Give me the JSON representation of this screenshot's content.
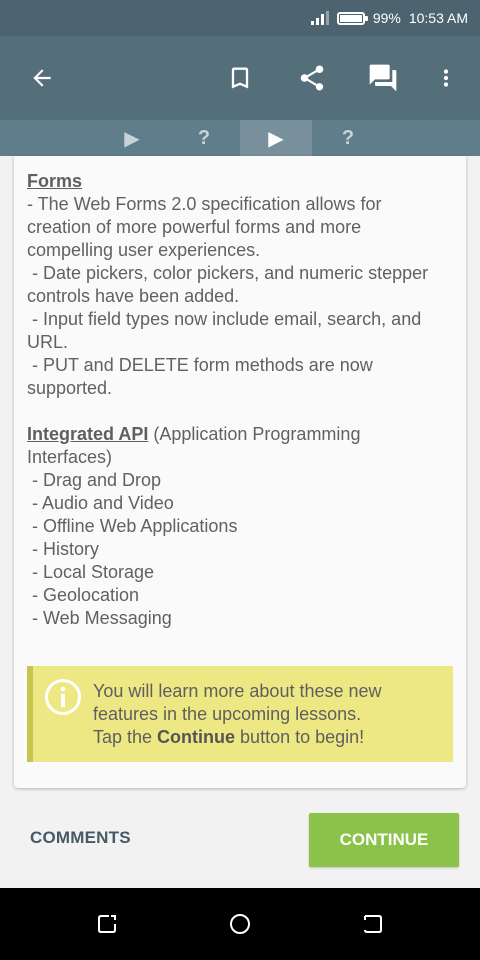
{
  "status_bar": {
    "battery": "99%",
    "time": "10:53 AM"
  },
  "toolbar": {
    "icons": [
      "back-arrow-icon",
      "bookmark-icon",
      "share-icon",
      "comments-icon",
      "more-vert-icon"
    ]
  },
  "tabs": [
    {
      "label": "▶",
      "active": false
    },
    {
      "label": "?",
      "active": false
    },
    {
      "label": "▶",
      "active": true
    },
    {
      "label": "?",
      "active": false
    }
  ],
  "content": {
    "forms_heading": "Forms",
    "forms_lines": [
      "- The Web Forms 2.0 specification allows for",
      "creation of more powerful forms and more",
      "compelling user experiences.",
      " - Date pickers, color pickers, and numeric stepper",
      "controls have been added.",
      " - Input field types now include email, search, and",
      "URL.",
      " - PUT and DELETE form methods are now",
      "supported."
    ],
    "api_heading": "Integrated API",
    "api_heading_rest": " (Application Programming",
    "api_line2": "Interfaces)",
    "api_items": [
      " - Drag and Drop",
      " - Audio and Video",
      " - Offline Web Applications",
      " - History",
      " - Local Storage",
      " - Geolocation",
      " - Web Messaging"
    ]
  },
  "note": {
    "line1": "You will learn more about these new",
    "line2": "features in the upcoming lessons.",
    "line3_prefix": "Tap the ",
    "line3_bold": "Continue",
    "line3_suffix": " button to begin!"
  },
  "actions": {
    "comments_label": "COMMENTS",
    "continue_label": "CONTINUE"
  },
  "colors": {
    "toolbar": "#546e7a",
    "tabs": "#607d8b",
    "continue": "#8bc34a",
    "note_bg": "#ede883"
  }
}
